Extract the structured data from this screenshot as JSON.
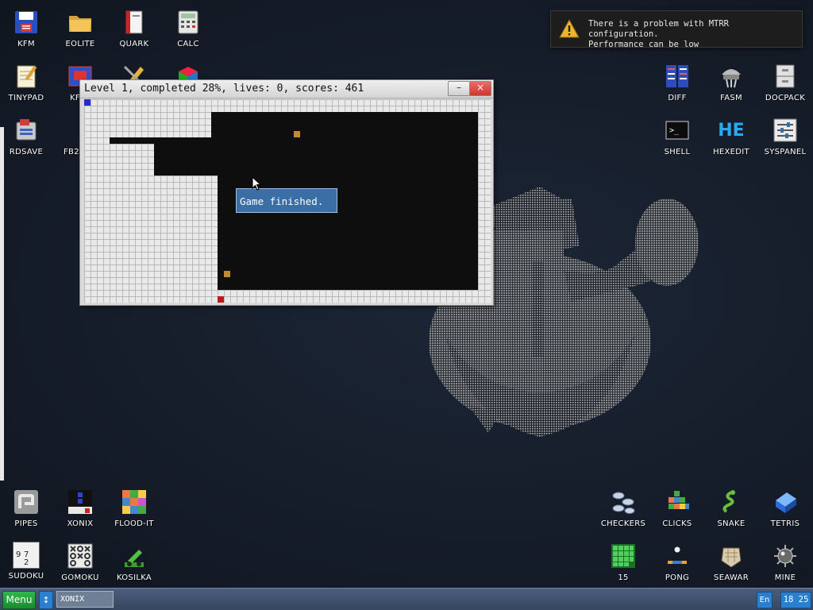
{
  "desktop": {
    "icons_top_left": [
      {
        "label": "KFM",
        "icon": "floppy-disk-icon"
      },
      {
        "label": "EOLITE",
        "icon": "folder-icon"
      },
      {
        "label": "QUARK",
        "icon": "book-icon"
      },
      {
        "label": "CALC",
        "icon": "calculator-icon"
      },
      {
        "label": "TINYPAD",
        "icon": "notepad-icon"
      },
      {
        "label": "RDSAVE",
        "icon": "disk-save-icon"
      }
    ],
    "icons_top_right": [
      {
        "label": "DIFF",
        "icon": "diff-icon"
      },
      {
        "label": "FASM",
        "icon": "fasm-icon"
      },
      {
        "label": "DOCPACK",
        "icon": "cabinet-icon"
      },
      {
        "label": "SHELL",
        "icon": "terminal-icon"
      },
      {
        "label": "HEXEDIT",
        "icon": "hex-editor-icon",
        "glyph": "HE"
      },
      {
        "label": "SYSPANEL",
        "icon": "sliders-icon"
      }
    ],
    "partial_labels": {
      "kf": "KF",
      "fb2": "FB2"
    },
    "icons_bottom_left": [
      {
        "label": "PIPES",
        "icon": "pipes-icon"
      },
      {
        "label": "XONIX",
        "icon": "xonix-icon"
      },
      {
        "label": "FLOOD-IT",
        "icon": "flood-it-icon"
      },
      {
        "label": "SUDOKU",
        "icon": "sudoku-icon",
        "glyph": [
          "9",
          "7",
          "2"
        ]
      },
      {
        "label": "GOMOKU",
        "icon": "gomoku-icon"
      },
      {
        "label": "KOSILKA",
        "icon": "lawn-mower-icon"
      }
    ],
    "icons_bottom_right": [
      {
        "label": "CHECKERS",
        "icon": "checkers-icon"
      },
      {
        "label": "CLICKS",
        "icon": "clicks-icon"
      },
      {
        "label": "SNAKE",
        "icon": "snake-icon"
      },
      {
        "label": "TETRIS",
        "icon": "tetris-icon"
      },
      {
        "label": "15",
        "icon": "fifteen-puzzle-icon"
      },
      {
        "label": "PONG",
        "icon": "pong-icon"
      },
      {
        "label": "SEAWAR",
        "icon": "seawar-icon"
      },
      {
        "label": "MINE",
        "icon": "mine-icon"
      }
    ]
  },
  "notification": {
    "icon": "warning-icon",
    "line1": "There is a problem with MTRR configuration.",
    "line2": "Performance can be low"
  },
  "game_window": {
    "title": "Level 1, completed 28%, lives: 0, scores: 461",
    "minimize_label": "–",
    "close_label": "×",
    "completed_percent": 28,
    "lives": 0,
    "scores": 461,
    "dialog_text": "Game finished."
  },
  "taskbar": {
    "menu_label": "Menu",
    "switch_label": "↕",
    "task_item": "XONIX",
    "language": "En",
    "clock": "18 25"
  },
  "colors": {
    "desktop_bg": "#151d2a",
    "field_filled": "#e9e9e9",
    "field_void": "#0e0e0e",
    "player": "#2a2acc",
    "ball": "#c58a2f",
    "enemy": "#c0181a",
    "dialog_bg": "#3a6ea5",
    "menu_green": "#1a8a30",
    "close_red": "#c93731"
  }
}
